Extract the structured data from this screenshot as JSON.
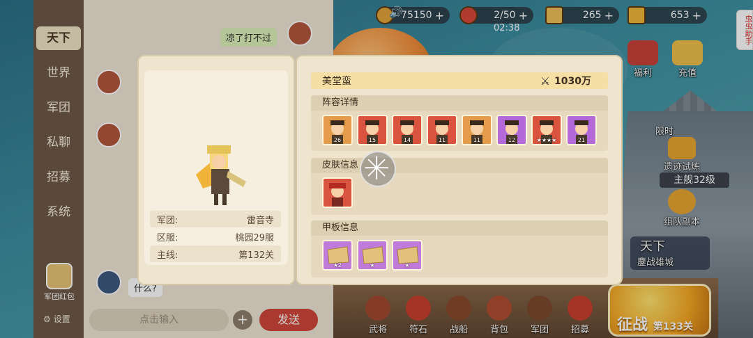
{
  "resources": [
    {
      "value": "75150",
      "color": "#e3a53b"
    },
    {
      "value": "2/50",
      "color": "#d9483b"
    },
    {
      "value": "265",
      "color": "#f0c05a"
    },
    {
      "value": "653",
      "color": "#f2b83a"
    }
  ],
  "timer": "02:38",
  "helper": "虫虫助手",
  "chat": {
    "tabs": [
      "天下",
      "世界",
      "军团",
      "私聊",
      "招募",
      "系统"
    ],
    "active_tab": "天下",
    "messages": [
      {
        "text": "凉了打不过",
        "self": true
      }
    ],
    "last_message": "什么?",
    "red_packet": "军团红包",
    "settings": "设置",
    "input_placeholder": "点击输入",
    "send": "发送"
  },
  "profile": {
    "rows": [
      {
        "label": "军团:",
        "value": "雷音寺"
      },
      {
        "label": "区服:",
        "value": "桃园29服"
      },
      {
        "label": "主线:",
        "value": "第132关"
      }
    ]
  },
  "player": {
    "name": "美堂蛮",
    "power": "1030万"
  },
  "sections": {
    "lineup": "阵容详情",
    "skin": "皮肤信息",
    "deck": "甲板信息"
  },
  "lineup_heroes": [
    {
      "level": "26",
      "color": "#e49b4a"
    },
    {
      "level": "15",
      "color": "#d9533f"
    },
    {
      "level": "14",
      "color": "#d9533f"
    },
    {
      "level": "11",
      "color": "#d9533f"
    },
    {
      "level": "11",
      "color": "#e49b4a"
    },
    {
      "level": "12",
      "color": "#b36ad8"
    },
    {
      "level": "★★★★",
      "color": "#d9533f"
    },
    {
      "level": "21",
      "color": "#b36ad8"
    }
  ],
  "skins": [
    {
      "color": "#d9533f"
    }
  ],
  "decks": [
    {
      "level": "★2",
      "color": "#c07ad9"
    },
    {
      "level": "★",
      "color": "#c07ad9"
    },
    {
      "level": "★",
      "color": "#c07ad9"
    }
  ],
  "features": {
    "welfare": "福利",
    "recharge": "充值",
    "limited": "限时",
    "relic": "遗迹试炼",
    "level_tag": "主舰32级",
    "team_dungeon": "组队副本",
    "tianxia": "天下",
    "city_war": "鏖战雄城"
  },
  "bottom_nav": [
    "武将",
    "符石",
    "战船",
    "背包",
    "军团",
    "招募"
  ],
  "fight": {
    "label": "征战",
    "stage": "第133关"
  }
}
